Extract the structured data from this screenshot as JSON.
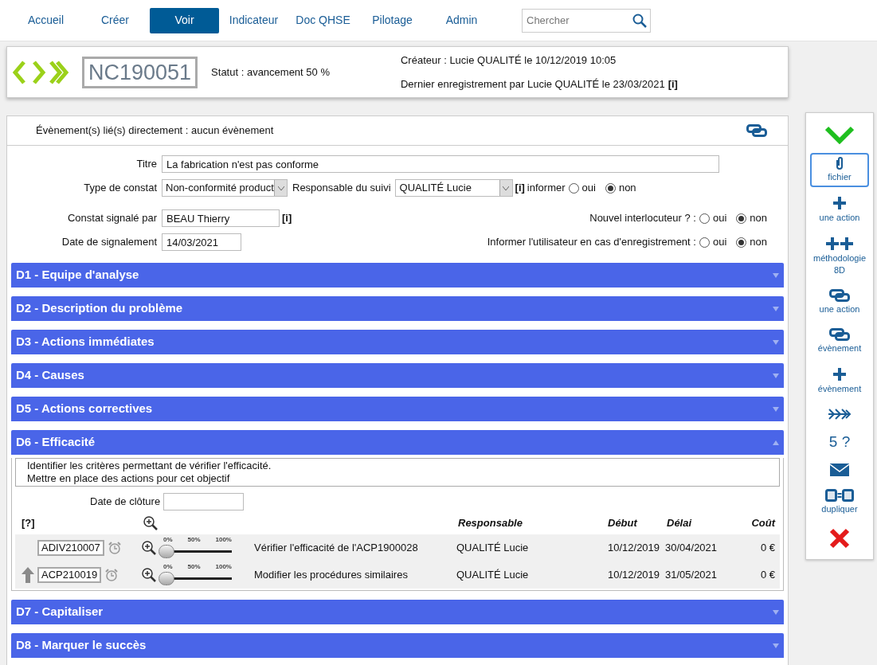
{
  "nav": {
    "items": [
      {
        "label": "Accueil",
        "selected": false
      },
      {
        "label": "Créer",
        "selected": false
      },
      {
        "label": "Voir",
        "selected": true
      },
      {
        "label": "Indicateur",
        "selected": false
      },
      {
        "label": "Doc QHSE",
        "selected": false
      },
      {
        "label": "Pilotage",
        "selected": false
      },
      {
        "label": "Admin",
        "selected": false
      }
    ],
    "search": {
      "placeholder": "Chercher"
    }
  },
  "header": {
    "code": "NC190051",
    "status": "Statut : avancement 50 %",
    "creator": "Créateur : Lucie QUALITÉ le 10/12/2019 10:05",
    "last_save": "Dernier enregistrement par Lucie QUALITÉ le 23/03/2021",
    "info": "[i]"
  },
  "linked_events": "Évènement(s) lié(s) directement : aucun évènement",
  "form": {
    "titre": {
      "label": "Titre",
      "value": "La fabrication n'est pas conforme"
    },
    "type": {
      "label": "Type de constat",
      "value": "Non-conformité product"
    },
    "responsable": {
      "label": "Responsable du suivi",
      "value": "QUALITÉ Lucie",
      "info": "[i]",
      "informer": "informer",
      "options": [
        {
          "label": "oui",
          "selected": false
        },
        {
          "label": "non",
          "selected": true
        }
      ]
    },
    "signale": {
      "label": "Constat signalé par",
      "value": "BEAU Thierry",
      "info": "[i]"
    },
    "date": {
      "label": "Date de signalement",
      "value": "14/03/2021"
    },
    "nouvel": {
      "label": "Nouvel interlocuteur ? :",
      "options": [
        {
          "label": "oui",
          "selected": false
        },
        {
          "label": "non",
          "selected": true
        }
      ]
    },
    "informer_user": {
      "label": "Informer l'utilisateur en cas d'enregistrement :",
      "options": [
        {
          "label": "oui",
          "selected": false
        },
        {
          "label": "non",
          "selected": true
        }
      ]
    }
  },
  "sections": [
    {
      "title": "D1 - Equipe d'analyse",
      "expanded": false
    },
    {
      "title": "D2 - Description du problème",
      "expanded": false
    },
    {
      "title": "D3 - Actions immédiates",
      "expanded": false
    },
    {
      "title": "D4 - Causes",
      "expanded": false
    },
    {
      "title": "D5 - Actions correctives",
      "expanded": false
    },
    {
      "title": "D6 - Efficacité",
      "expanded": true,
      "body": {
        "description": [
          "Identifier les critères permettant de vérifier l'efficacité.",
          "Mettre en place des actions pour cet objectif"
        ],
        "closing_date": {
          "label": "Date de clôture"
        },
        "headers": {
          "help": "[?]",
          "responsable": "Responsable",
          "debut": "Début",
          "delai": "Délai",
          "cout": "Coût"
        },
        "rows": [
          {
            "code": "ADIV210007",
            "up_arrow": false,
            "level": 0,
            "slider_ticks": [
              "0%",
              "50%",
              "100%"
            ],
            "label": "Vérifier l'efficacité de l'ACP1900028",
            "responsable": "QUALITÉ Lucie",
            "debut": "10/12/2019",
            "delai": "30/04/2021",
            "cout": "0 €"
          },
          {
            "code": "ACP210019",
            "up_arrow": true,
            "level": 0,
            "slider_ticks": [
              "0%",
              "50%",
              "100%"
            ],
            "label": "Modifier les procédures similaires",
            "responsable": "QUALITÉ Lucie",
            "debut": "10/12/2019",
            "delai": "31/05/2021",
            "cout": "0 €"
          }
        ]
      }
    },
    {
      "title": "D7 - Capitaliser",
      "expanded": false
    },
    {
      "title": "D8 - Marquer le succès",
      "expanded": false
    }
  ],
  "sidebar": [
    {
      "kind": "validate",
      "highlighted": false
    },
    {
      "kind": "attach",
      "label": "fichier",
      "highlighted": true
    },
    {
      "kind": "add",
      "label": "une action",
      "highlighted": false
    },
    {
      "kind": "add_multi",
      "label": "méthodologie 8D",
      "highlighted": false
    },
    {
      "kind": "link",
      "label": "une action",
      "highlighted": false
    },
    {
      "kind": "link",
      "label": "évènement",
      "highlighted": false
    },
    {
      "kind": "add",
      "label": "évènement",
      "highlighted": false
    },
    {
      "kind": "route",
      "highlighted": false
    },
    {
      "kind": "text",
      "label": "5 ?",
      "highlighted": false
    },
    {
      "kind": "mail",
      "highlighted": false
    },
    {
      "kind": "duplicate",
      "label": "dupliquer",
      "highlighted": false
    },
    {
      "kind": "delete",
      "highlighted": false
    }
  ]
}
